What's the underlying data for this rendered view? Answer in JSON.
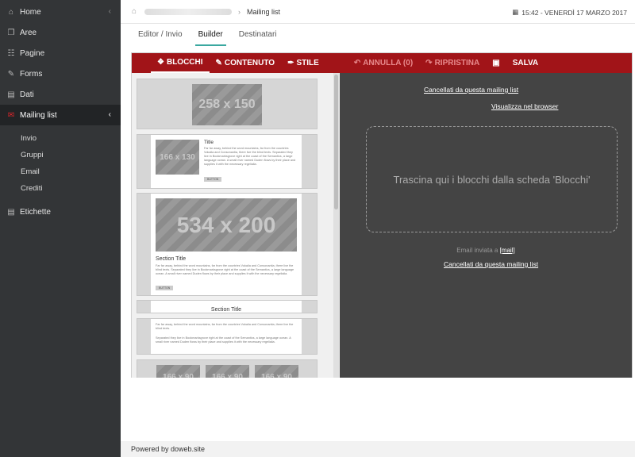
{
  "sidebar": {
    "items": [
      {
        "label": "Home",
        "icon": "home-icon"
      },
      {
        "label": "Aree",
        "icon": "copy-icon"
      },
      {
        "label": "Pagine",
        "icon": "sitemap-icon"
      },
      {
        "label": "Forms",
        "icon": "edit-icon"
      },
      {
        "label": "Dati",
        "icon": "database-icon"
      },
      {
        "label": "Mailing list",
        "icon": "envelope-icon"
      },
      {
        "label": "Etichette",
        "icon": "document-icon"
      }
    ],
    "subitems": [
      "Invio",
      "Gruppi",
      "Email",
      "Crediti"
    ]
  },
  "header": {
    "breadcrumb_current": "Mailing list",
    "clock": "15:42 - VENERDÌ 17 MARZO 2017"
  },
  "tabs": [
    "Editor / Invio",
    "Builder",
    "Destinatari"
  ],
  "toolbar": {
    "blocks": "BLOCCHI",
    "content": "CONTENUTO",
    "style": "STILE",
    "undo": "ANNULLA (0)",
    "redo": "RIPRISTINA",
    "save": "SALVA"
  },
  "blocks": {
    "ph1": "258 x 150",
    "ph2": "166 x 130",
    "title": "Title",
    "para_a": "Far far away, behind the word mountains, far from the countries Vokalia and Consonantia, there live the blind texts. Separated they live in Bookmarksgrove right at the coast of the Semantics, a large language ocean. A small river named Duden flows by their place and supplies it with the necessary regelialia.",
    "button": "BUTTON",
    "ph3": "534 x 200",
    "section_title": "Section Title",
    "para_b": "Far far away, behind the word mountains, far from the countries Vokalia and Consonantia, there live the blind texts. Separated they live in Bookmarksgrove right at the coast of the Semantics, a large language ocean. A small river named Duden flows by their place and supplies it with the necessary regelialia.",
    "para_c1": "Far far away, behind the word mountains, far from the countries Vokalia and Consonantia, there live the blind texts.",
    "para_c2": "Separated they live in Bookmarksgrove right at the coast of the Semantics, a large language ocean. A small river named Duden flows by their place and supplies it with the necessary regelialia.",
    "ph4": "166 x 90"
  },
  "canvas": {
    "unsubscribe_top": "Cancellati da questa mailing list",
    "view_browser": "Visualizza nel browser",
    "dropzone": "Trascina qui i blocchi dalla scheda 'Blocchi'",
    "sent_to": "Email inviata a",
    "mail_tag": "[mail]",
    "unsubscribe_bottom": "Cancellati da questa mailing list"
  },
  "footer": {
    "text": "Powered by doweb.site"
  }
}
